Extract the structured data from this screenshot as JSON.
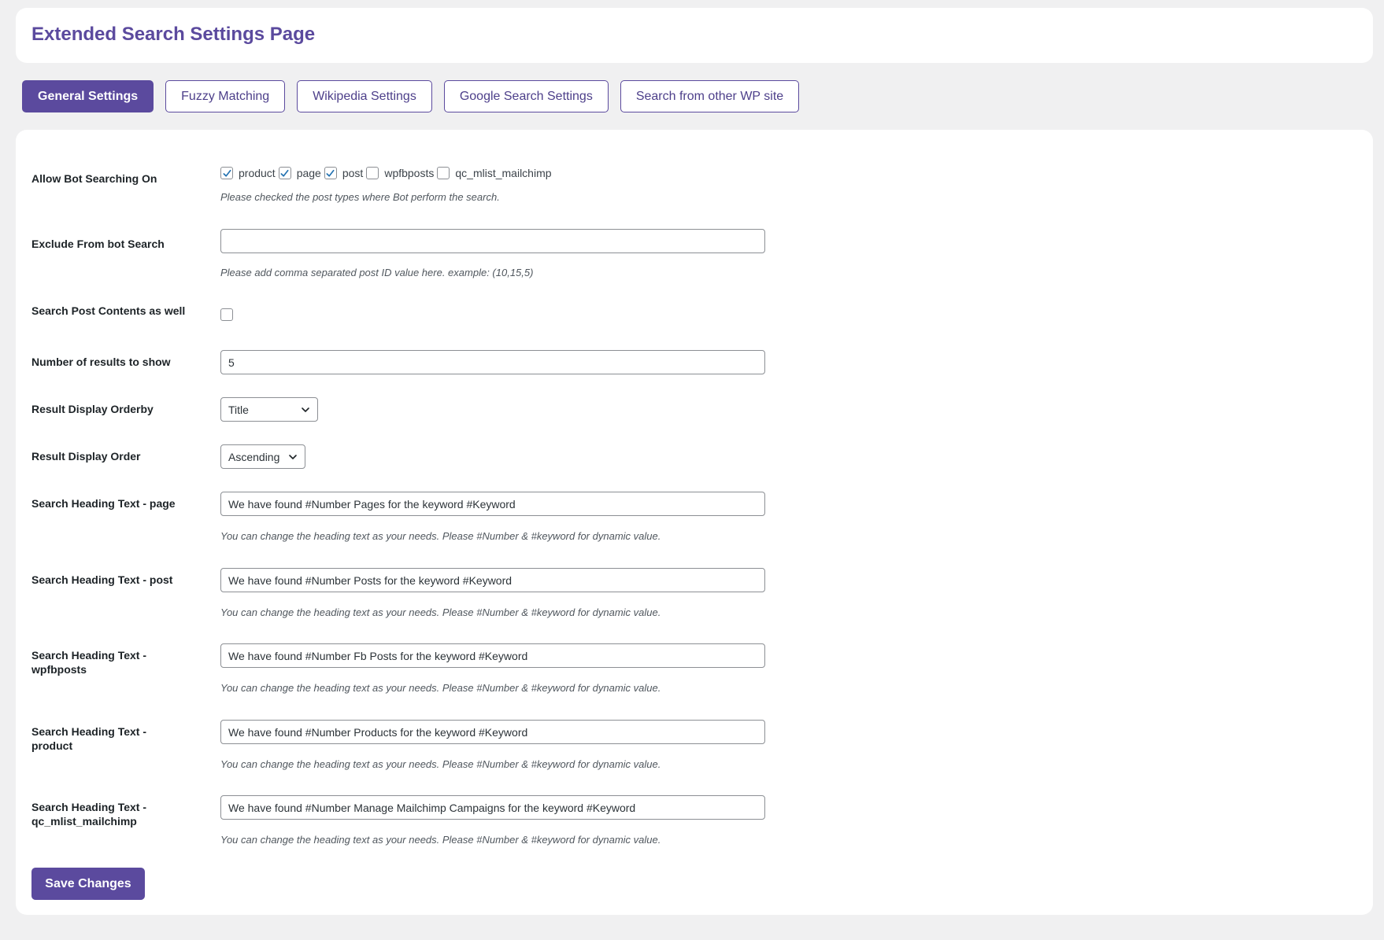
{
  "page": {
    "title": "Extended Search Settings Page"
  },
  "tabs": [
    {
      "label": "General Settings",
      "active": true
    },
    {
      "label": "Fuzzy Matching",
      "active": false
    },
    {
      "label": "Wikipedia Settings",
      "active": false
    },
    {
      "label": "Google Search Settings",
      "active": false
    },
    {
      "label": "Search from other WP site",
      "active": false
    }
  ],
  "settings": {
    "allow_bot": {
      "label": "Allow Bot Searching On",
      "options": [
        {
          "label": "product",
          "checked": true
        },
        {
          "label": "page",
          "checked": true
        },
        {
          "label": "post",
          "checked": true
        },
        {
          "label": "wpfbposts",
          "checked": false
        },
        {
          "label": "qc_mlist_mailchimp",
          "checked": false
        }
      ],
      "description": "Please checked the post types where Bot perform the search."
    },
    "exclude": {
      "label": "Exclude From bot Search",
      "value": "",
      "description": "Please add comma separated post ID value here. example: (10,15,5)"
    },
    "search_contents": {
      "label": "Search Post Contents as well",
      "checked": false
    },
    "num_results": {
      "label": "Number of results to show",
      "value": "5"
    },
    "orderby": {
      "label": "Result Display Orderby",
      "value": "Title"
    },
    "order": {
      "label": "Result Display Order",
      "value": "Ascending"
    },
    "heading_page": {
      "label": "Search Heading Text - page",
      "value": "We have found #Number Pages for the keyword #Keyword",
      "description": "You can change the heading text as your needs. Please #Number & #keyword for dynamic value."
    },
    "heading_post": {
      "label": "Search Heading Text - post",
      "value": "We have found #Number Posts for the keyword #Keyword",
      "description": "You can change the heading text as your needs. Please #Number & #keyword for dynamic value."
    },
    "heading_wpfbposts": {
      "label": "Search Heading Text - wpfbposts",
      "value": "We have found #Number Fb Posts for the keyword #Keyword",
      "description": "You can change the heading text as your needs. Please #Number & #keyword for dynamic value."
    },
    "heading_product": {
      "label": "Search Heading Text - product",
      "value": "We have found #Number Products for the keyword #Keyword",
      "description": "You can change the heading text as your needs. Please #Number & #keyword for dynamic value."
    },
    "heading_mailchimp": {
      "label": "Search Heading Text - qc_mlist_mailchimp",
      "value": "We have found #Number Manage Mailchimp Campaigns for the keyword #Keyword",
      "description": "You can change the heading text as your needs. Please #Number & #keyword for dynamic value."
    }
  },
  "actions": {
    "save_label": "Save Changes"
  },
  "colors": {
    "accent": "#5b4a9e",
    "check": "#2271b1"
  },
  "icons": {
    "check": "checkmark-icon",
    "dropdown": "chevron-down-icon"
  }
}
